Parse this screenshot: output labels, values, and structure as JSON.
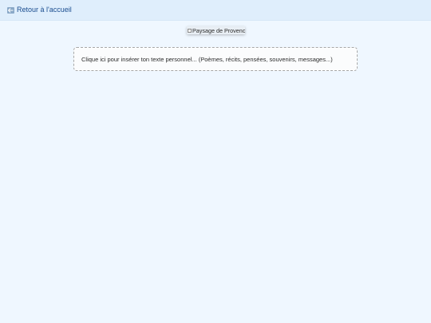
{
  "header": {
    "back_label": "Retour à l'accueil",
    "back_icon": "back-arrow-icon"
  },
  "main": {
    "image_alt": "Paysage de Provence",
    "text_placeholder": "Clique ici pour insérer ton texte personnel... (Poèmes, récits, pensées, souvenirs, messages...)"
  },
  "colors": {
    "background": "#eff7ff",
    "header_background": "#dfeefc",
    "link": "#1a4d8f"
  }
}
